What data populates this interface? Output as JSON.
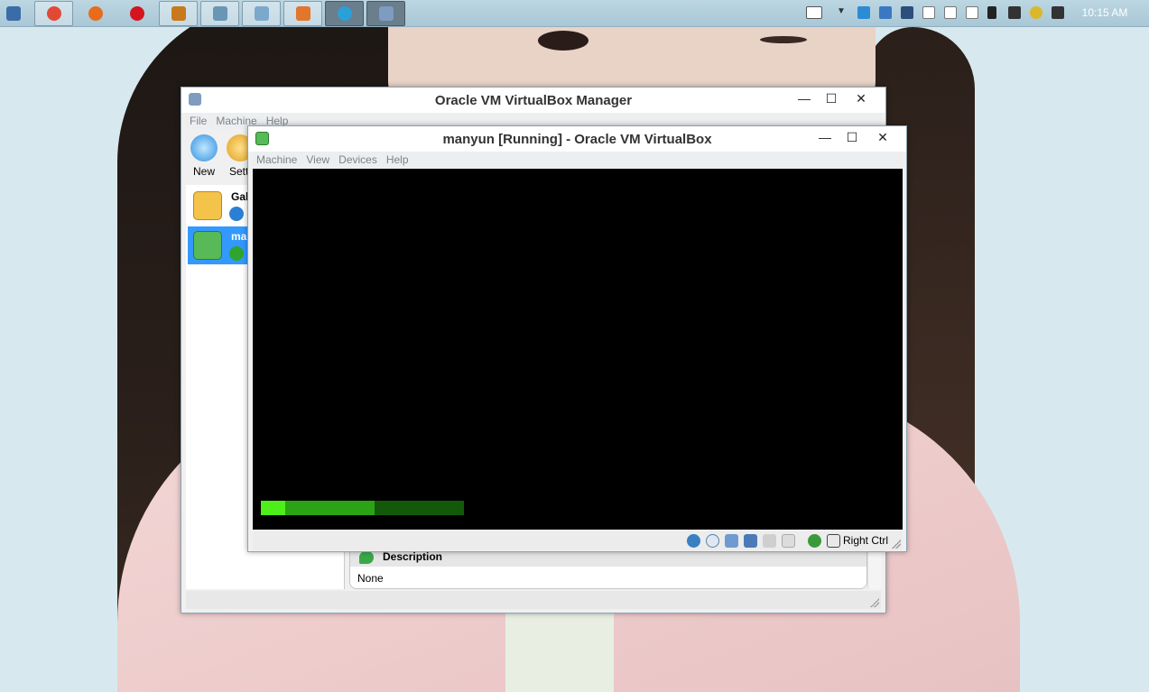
{
  "taskbar": {
    "apps": [
      {
        "name": "chrome",
        "color": "#e04a35"
      },
      {
        "name": "firefox",
        "color": "#e86c1b"
      },
      {
        "name": "opera",
        "color": "#d4141e"
      },
      {
        "name": "media-player",
        "color": "#c8791e"
      },
      {
        "name": "photo-viewer",
        "color": "#6a96b5"
      },
      {
        "name": "notepad",
        "color": "#7aa9cc"
      },
      {
        "name": "app-orange",
        "color": "#e2762a"
      },
      {
        "name": "browser-blue",
        "color": "#2aa0d8"
      },
      {
        "name": "virtualbox",
        "color": "#7e9bc0"
      }
    ],
    "clock": "10:15 AM"
  },
  "manager": {
    "title": "Oracle VM VirtualBox Manager",
    "menu": [
      "File",
      "Machine",
      "Help"
    ],
    "toolbar": {
      "new_label": "New",
      "settings_label": "Setti"
    },
    "vms": [
      {
        "name": "Gal",
        "state_color": "#2b7fd6",
        "selected": false
      },
      {
        "name": "ma",
        "state_color": "#2fa52f",
        "selected": true
      }
    ],
    "description": {
      "heading": "Description",
      "value": "None"
    }
  },
  "vm_window": {
    "title": "manyun [Running] - Oracle VM VirtualBox",
    "menu": [
      "Machine",
      "View",
      "Devices",
      "Help"
    ],
    "host_key": "Right Ctrl",
    "boot_progress": {
      "bright_fraction": 0.12,
      "mid_fraction": 0.56
    }
  },
  "colors": {
    "selection": "#3399ff",
    "boot_green": "#4dee19"
  }
}
